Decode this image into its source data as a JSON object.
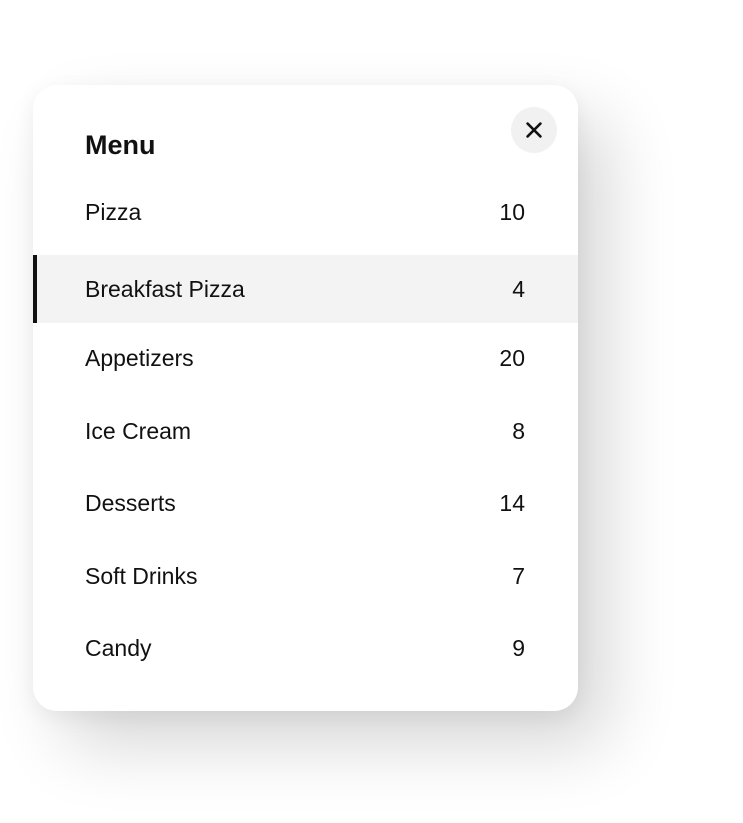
{
  "menu": {
    "title": "Menu",
    "close_icon": "close-icon",
    "active_index": 1,
    "items": [
      {
        "label": "Pizza",
        "count": "10"
      },
      {
        "label": "Breakfast Pizza",
        "count": "4"
      },
      {
        "label": "Appetizers",
        "count": "20"
      },
      {
        "label": "Ice Cream",
        "count": "8"
      },
      {
        "label": "Desserts",
        "count": "14"
      },
      {
        "label": "Soft Drinks",
        "count": "7"
      },
      {
        "label": "Candy",
        "count": "9"
      }
    ]
  },
  "colors": {
    "text": "#111111",
    "active_bg": "#f3f3f3",
    "close_bg": "#f1f1f1",
    "active_indicator": "#111111"
  }
}
